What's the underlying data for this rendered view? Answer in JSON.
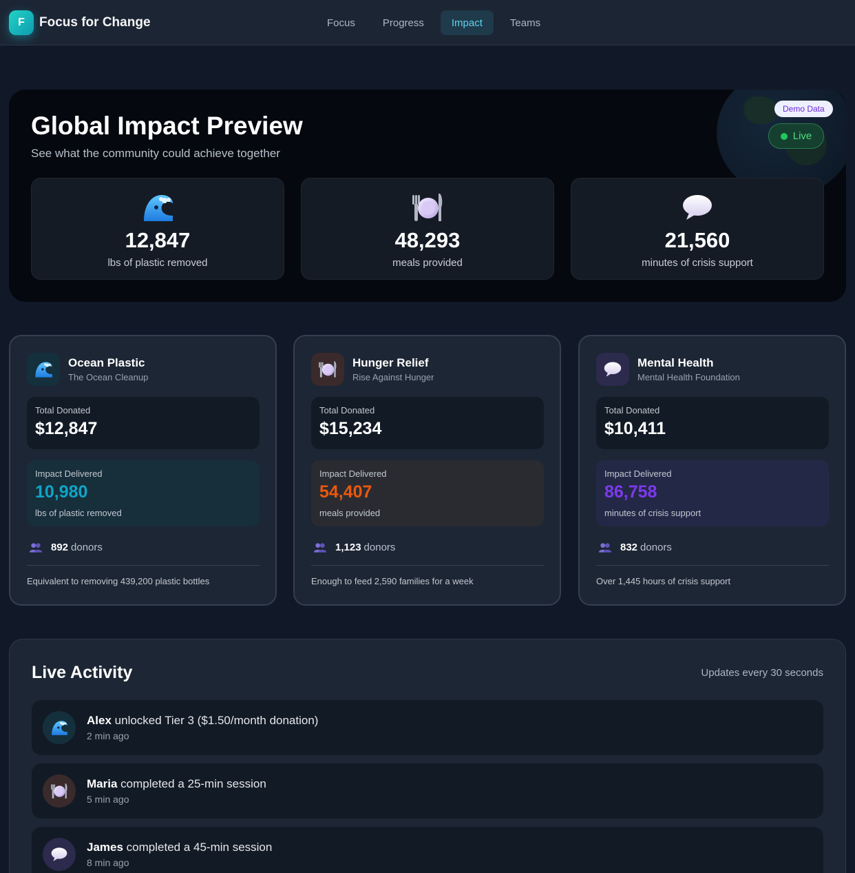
{
  "app": {
    "logo_letter": "F",
    "name": "Focus for Change"
  },
  "nav": {
    "items": [
      {
        "label": "Focus",
        "active": false
      },
      {
        "label": "Progress",
        "active": false
      },
      {
        "label": "Impact",
        "active": true
      },
      {
        "label": "Teams",
        "active": false
      }
    ]
  },
  "hero": {
    "title": "Global Impact Preview",
    "subtitle": "See what the community could achieve together",
    "demo_badge": "Demo Data",
    "live_badge": "Live",
    "stats": [
      {
        "icon": "wave-icon",
        "value": "12,847",
        "label": "lbs of plastic removed"
      },
      {
        "icon": "plate-icon",
        "value": "48,293",
        "label": "meals provided"
      },
      {
        "icon": "speech-bubble-icon",
        "value": "21,560",
        "label": "minutes of crisis support"
      }
    ]
  },
  "causes": [
    {
      "icon": "wave-icon",
      "name": "Ocean Plastic",
      "org": "The Ocean Cleanup",
      "donated_label": "Total Donated",
      "donated": "$12,847",
      "impact_label": "Impact Delivered",
      "impact": "10,980",
      "impact_unit": "lbs of plastic removed",
      "impact_color": "#0ea5c6",
      "donors_count": "892",
      "donors_label": "donors",
      "footnote": "Equivalent to removing 439,200 plastic bottles"
    },
    {
      "icon": "plate-icon",
      "name": "Hunger Relief",
      "org": "Rise Against Hunger",
      "donated_label": "Total Donated",
      "donated": "$15,234",
      "impact_label": "Impact Delivered",
      "impact": "54,407",
      "impact_unit": "meals provided",
      "impact_color": "#ea580c",
      "donors_count": "1,123",
      "donors_label": "donors",
      "footnote": "Enough to feed 2,590 families for a week"
    },
    {
      "icon": "speech-bubble-icon",
      "name": "Mental Health",
      "org": "Mental Health Foundation",
      "donated_label": "Total Donated",
      "donated": "$10,411",
      "impact_label": "Impact Delivered",
      "impact": "86,758",
      "impact_unit": "minutes of crisis support",
      "impact_color": "#7c3aed",
      "donors_count": "832",
      "donors_label": "donors",
      "footnote": "Over 1,445 hours of crisis support"
    }
  ],
  "activity": {
    "title": "Live Activity",
    "note": "Updates every 30 seconds",
    "items": [
      {
        "icon": "wave-icon",
        "user": "Alex",
        "action": "unlocked Tier 3 ($1.50/month donation)",
        "time": "2 min ago"
      },
      {
        "icon": "plate-icon",
        "user": "Maria",
        "action": "completed a 25-min session",
        "time": "5 min ago"
      },
      {
        "icon": "speech-bubble-icon",
        "user": "James",
        "action": "completed a 45-min session",
        "time": "8 min ago"
      }
    ]
  }
}
